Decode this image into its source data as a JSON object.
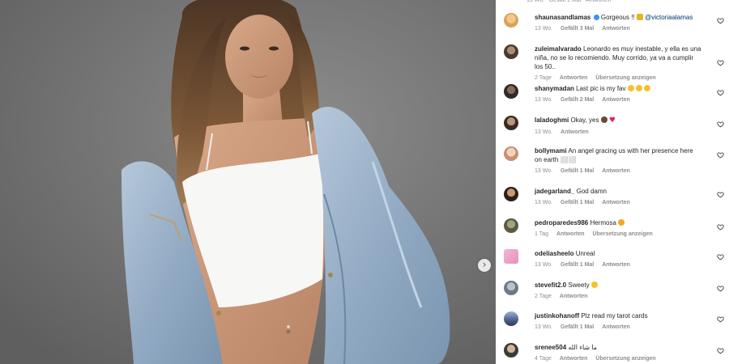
{
  "post": {
    "next_icon": "chevron-right-icon"
  },
  "comments": [
    {
      "username": "shaunasandlamas",
      "verified": true,
      "text": "Gorgeous !! ",
      "emoji": "bee",
      "mention": "@victoriaalamas",
      "time": "13 Wo.",
      "likes": "Gefällt 3 Mal",
      "reply": "Antworten",
      "translate": ""
    },
    {
      "username": "zuleimalvarado",
      "text": "Leonardo es muy inestable, y ella es una niña, no se lo recomiendo. Muy corrido, ya va a cumplir los 50..",
      "time": "2 Tage",
      "likes": "",
      "reply": "Antworten",
      "translate": "Übersetzung anzeigen"
    },
    {
      "username": "shanymadan",
      "text": "Last pic is my fav",
      "emoji": "grin x3",
      "time": "13 Wo.",
      "likes": "Gefällt 2 Mal",
      "reply": "Antworten",
      "translate": ""
    },
    {
      "username": "laladoghmi",
      "text": "Okay, yes",
      "emoji": "face, red heart",
      "time": "13 Wo.",
      "likes": "",
      "reply": "Antworten",
      "translate": ""
    },
    {
      "username": "bollymami",
      "text": "An angel gracing us with her presence here on earth ⬜⬜",
      "time": "13 Wo.",
      "likes": "Gefällt 1 Mal",
      "reply": "Antworten",
      "translate": ""
    },
    {
      "username": "jadegarland_",
      "text": "God damn",
      "time": "13 Wo.",
      "likes": "Gefällt 1 Mal",
      "reply": "Antworten",
      "translate": ""
    },
    {
      "username": "pedroparedes986",
      "text": "Hermosa",
      "emoji": "heart-eyes",
      "time": "1 Tag",
      "likes": "",
      "reply": "Antworten",
      "translate": "Übersetzung anzeigen"
    },
    {
      "username": "odeliasheelo",
      "text": "Unreal",
      "time": "13 Wo.",
      "likes": "Gefällt 1 Mal",
      "reply": "Antworten",
      "translate": ""
    },
    {
      "username": "stevefit2.0",
      "text": "Sweety",
      "emoji": "smile",
      "time": "2 Tage",
      "likes": "",
      "reply": "Antworten",
      "translate": ""
    },
    {
      "username": "justinkohanoff",
      "text": "Plz read my tarot cards",
      "time": "13 Wo.",
      "likes": "Gefällt 1 Mal",
      "reply": "Antworten",
      "translate": ""
    },
    {
      "username": "srenee504",
      "text": "ما شاء الله",
      "time": "4 Tage",
      "likes": "",
      "reply": "Antworten",
      "translate": "Übersetzung anzeigen"
    }
  ],
  "icons": {
    "like": "heart-outline-icon",
    "verified": "verified-badge-icon"
  },
  "colors": {
    "text": "#262626",
    "secondary": "#8e8e8e",
    "mention": "#00376b",
    "verified": "#3897f0"
  }
}
